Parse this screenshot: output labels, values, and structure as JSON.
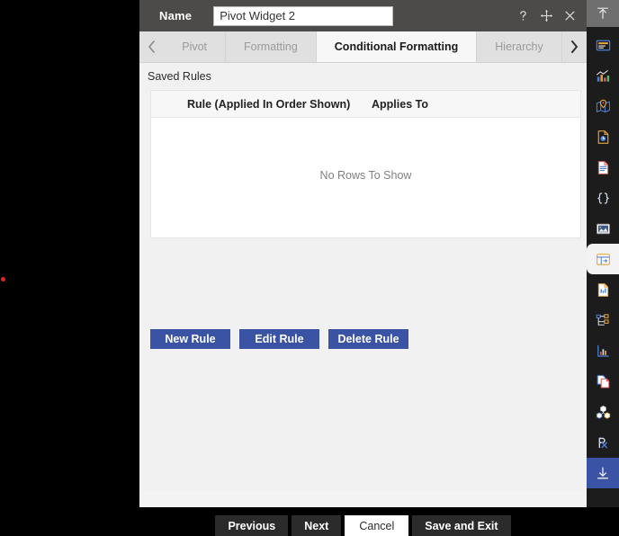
{
  "window": {
    "background_color": "#000000",
    "marker_dot_color": "#e02424"
  },
  "dialog": {
    "header": {
      "name_label": "Name",
      "name_value": "Pivot Widget 2",
      "name_placeholder": "Name",
      "icons": [
        {
          "name": "help-icon",
          "glyph": "?"
        },
        {
          "name": "move-icon",
          "glyph": "move"
        },
        {
          "name": "close-icon",
          "glyph": "x"
        }
      ],
      "background_color": "#4d4b49"
    },
    "tabs": {
      "prev_arrow": "‹",
      "next_arrow": "›",
      "items": [
        {
          "label": "Pivot",
          "active": false
        },
        {
          "label": "Formatting",
          "active": false
        },
        {
          "label": "Conditional Formatting",
          "active": true
        },
        {
          "label": "Hierarchy",
          "active": false
        }
      ]
    },
    "section_title": "Saved Rules",
    "grid": {
      "columns": [
        "Rule (Applied In Order Shown)",
        "Applies To"
      ],
      "rows": [],
      "empty_message": "No Rows To Show"
    },
    "rule_buttons": [
      {
        "label": "New Rule",
        "name": "new-rule-button"
      },
      {
        "label": "Edit Rule",
        "name": "edit-rule-button"
      },
      {
        "label": "Delete Rule",
        "name": "delete-rule-button"
      }
    ],
    "rule_button_color": "#3a53a4",
    "footer_buttons": [
      {
        "label": "Previous",
        "name": "previous-button",
        "style": "dark"
      },
      {
        "label": "Next",
        "name": "next-button",
        "style": "dark"
      },
      {
        "label": "Cancel",
        "name": "cancel-button",
        "style": "light"
      },
      {
        "label": "Save and Exit",
        "name": "save-and-exit-button",
        "style": "dark"
      }
    ]
  },
  "sidebar": {
    "background_color": "#1c1c1c",
    "accent_color": "#3a53a4",
    "items": [
      {
        "name": "upload-icon",
        "state": "header"
      },
      {
        "name": "card-widget-icon",
        "state": "normal"
      },
      {
        "name": "bar-chart-icon",
        "state": "normal"
      },
      {
        "name": "map-pin-icon",
        "state": "normal"
      },
      {
        "name": "document-clock-icon",
        "state": "normal"
      },
      {
        "name": "text-document-icon",
        "state": "normal"
      },
      {
        "name": "code-braces-icon",
        "state": "normal"
      },
      {
        "name": "image-icon",
        "state": "normal"
      },
      {
        "name": "pivot-widget-icon",
        "state": "selected"
      },
      {
        "name": "report-document-icon",
        "state": "normal"
      },
      {
        "name": "tree-hierarchy-icon",
        "state": "normal"
      },
      {
        "name": "line-chart-icon",
        "state": "normal"
      },
      {
        "name": "copy-pages-icon",
        "state": "normal"
      },
      {
        "name": "cubes-group-icon",
        "state": "normal"
      },
      {
        "name": "prescription-rx-icon",
        "state": "normal"
      },
      {
        "name": "download-icon",
        "state": "accent"
      }
    ]
  }
}
